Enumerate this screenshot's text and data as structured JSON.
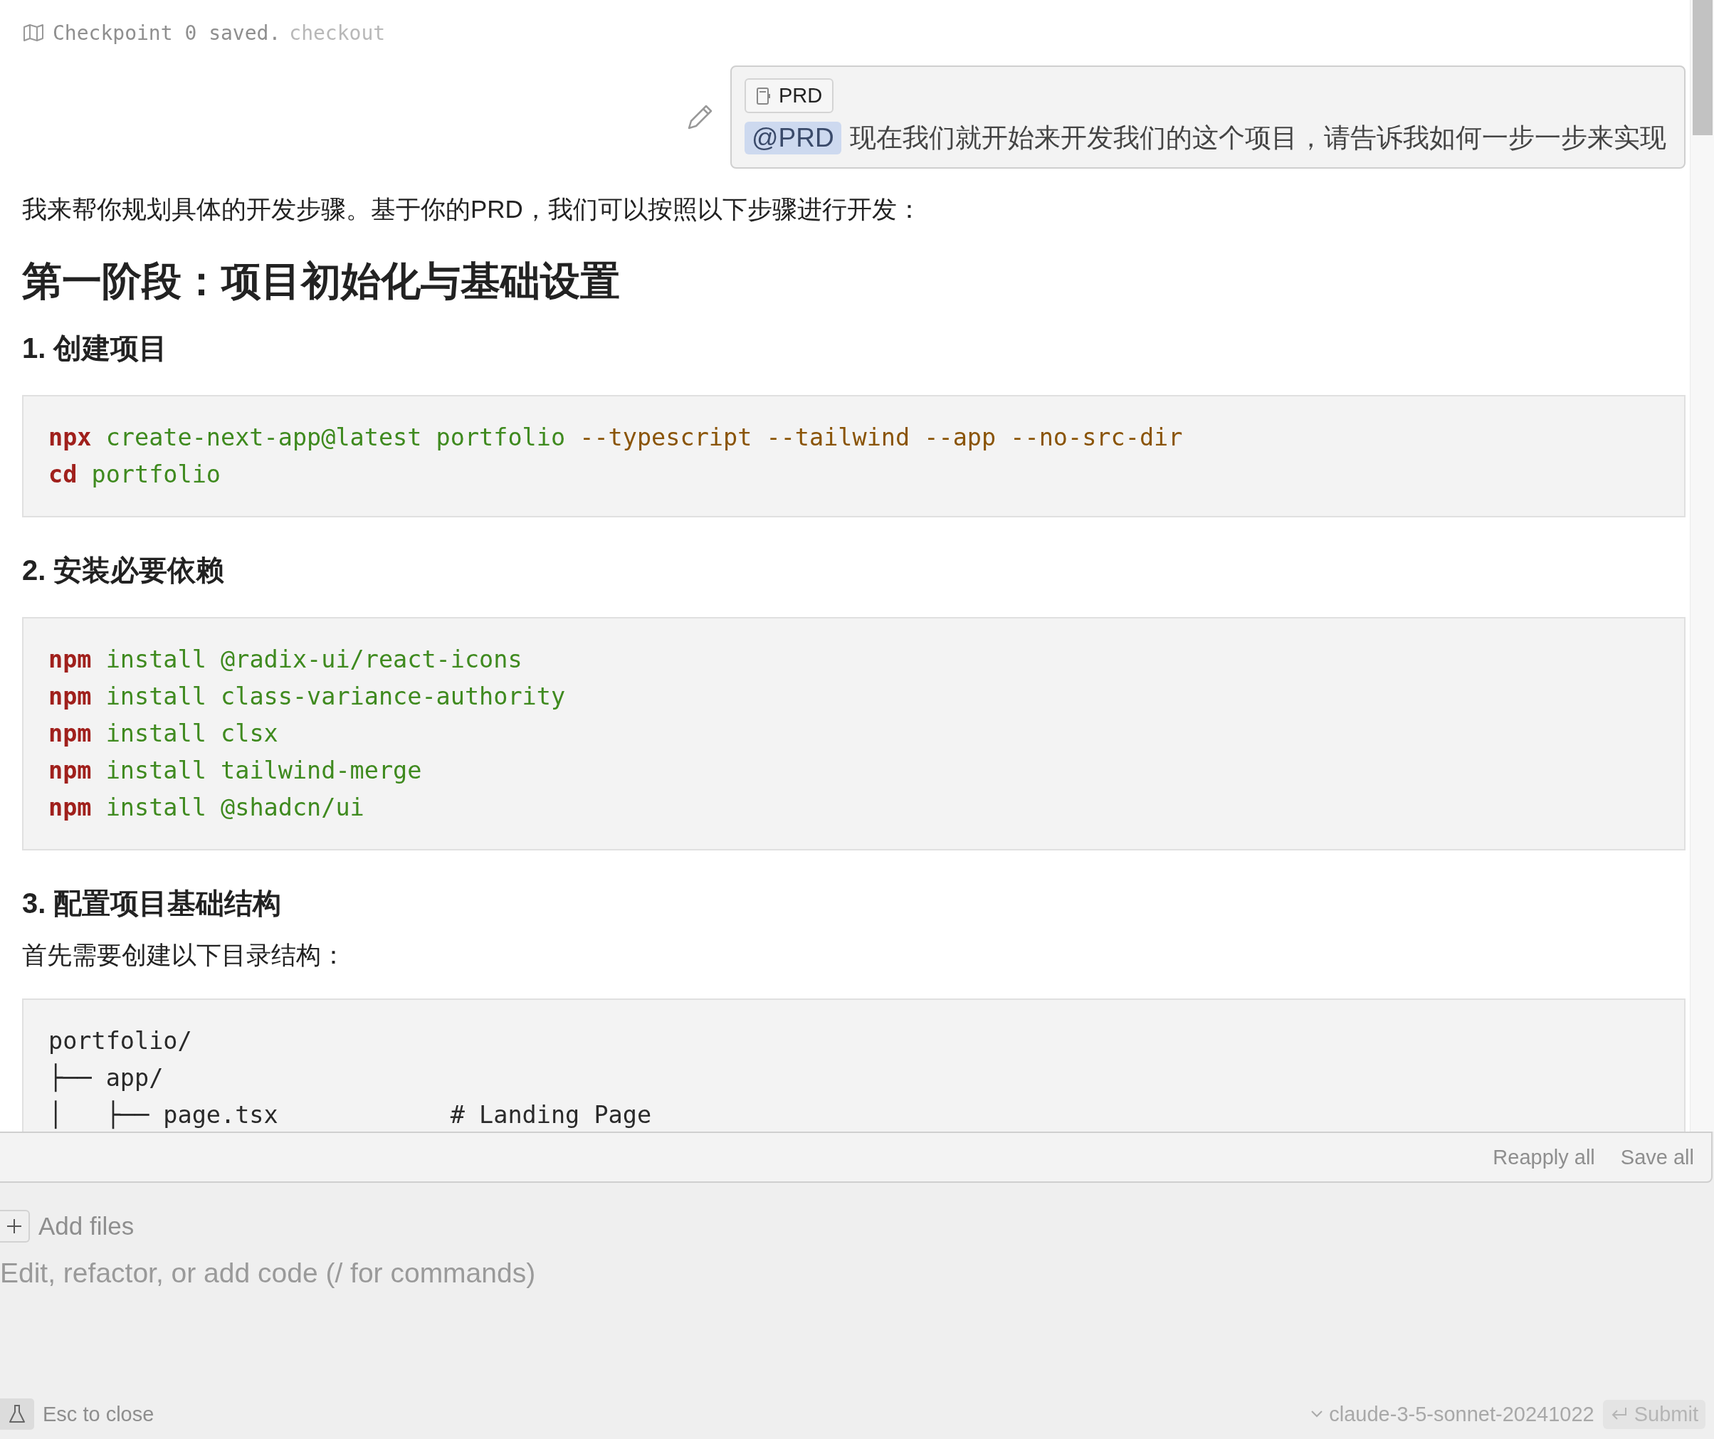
{
  "checkpoint": {
    "text": "Checkpoint 0 saved.",
    "action": "checkout"
  },
  "user_message": {
    "attachment": "PRD",
    "mention": "@PRD",
    "text": "现在我们就开始来开发我们的这个项目，请告诉我如何一步一步来实现"
  },
  "response": [
    {
      "kind": "paragraph",
      "text": "我来帮你规划具体的开发步骤。基于你的PRD，我们可以按照以下步骤进行开发："
    },
    {
      "kind": "h2",
      "text": "第一阶段：项目初始化与基础设置"
    },
    {
      "kind": "h3",
      "text": "1. 创建项目"
    },
    {
      "kind": "code",
      "lines": [
        [
          {
            "kind": "command",
            "text": "npx"
          },
          {
            "kind": "arg",
            "text": "create-next-app@latest"
          },
          {
            "kind": "arg",
            "text": "portfolio"
          },
          {
            "kind": "flag",
            "text": "--typescript"
          },
          {
            "kind": "flag",
            "text": "--tailwind"
          },
          {
            "kind": "flag",
            "text": "--app"
          },
          {
            "kind": "flag",
            "text": "--no-src-dir"
          }
        ],
        [
          {
            "kind": "command",
            "text": "cd"
          },
          {
            "kind": "arg",
            "text": "portfolio"
          }
        ]
      ]
    },
    {
      "kind": "h3",
      "text": "2. 安装必要依赖"
    },
    {
      "kind": "code",
      "lines": [
        [
          {
            "kind": "command",
            "text": "npm"
          },
          {
            "kind": "arg",
            "text": "install"
          },
          {
            "kind": "arg",
            "text": "@radix-ui/react-icons"
          }
        ],
        [
          {
            "kind": "command",
            "text": "npm"
          },
          {
            "kind": "arg",
            "text": "install"
          },
          {
            "kind": "arg",
            "text": "class-variance-authority"
          }
        ],
        [
          {
            "kind": "command",
            "text": "npm"
          },
          {
            "kind": "arg",
            "text": "install"
          },
          {
            "kind": "arg",
            "text": "clsx"
          }
        ],
        [
          {
            "kind": "command",
            "text": "npm"
          },
          {
            "kind": "arg",
            "text": "install"
          },
          {
            "kind": "arg",
            "text": "tailwind-merge"
          }
        ],
        [
          {
            "kind": "command",
            "text": "npm"
          },
          {
            "kind": "arg",
            "text": "install"
          },
          {
            "kind": "arg",
            "text": "@shadcn/ui"
          }
        ]
      ]
    },
    {
      "kind": "h3",
      "text": "3. 配置项目基础结构"
    },
    {
      "kind": "paragraph",
      "text": "首先需要创建以下目录结构："
    },
    {
      "kind": "code",
      "lines": [
        [
          {
            "kind": "plain",
            "text": "portfolio/"
          }
        ],
        [
          {
            "kind": "plain",
            "text": "├── app/"
          }
        ],
        [
          {
            "kind": "plain",
            "text": "│   ├── page.tsx            # Landing Page"
          }
        ]
      ]
    }
  ],
  "actions": [
    "Reapply all",
    "Save all"
  ],
  "composer": {
    "add_files": "Add files",
    "placeholder": "Edit, refactor, or add code (/ for commands)",
    "hint": "Esc to close",
    "model": "claude-3-5-sonnet-20241022",
    "submit": "Submit"
  }
}
